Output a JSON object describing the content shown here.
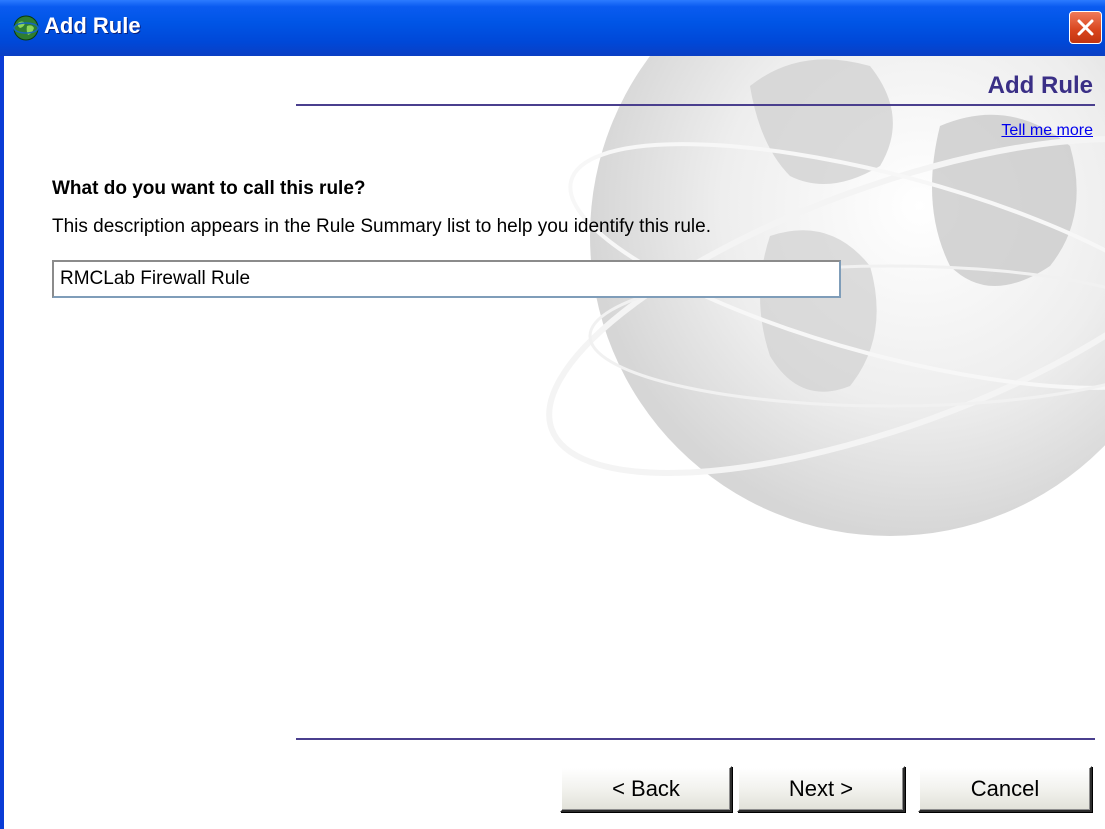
{
  "window": {
    "title": "Add Rule"
  },
  "header": {
    "title": "Add Rule",
    "help_link": "Tell me more"
  },
  "form": {
    "question": "What do you want to call this rule?",
    "description": "This description appears in the Rule Summary list to help you identify this rule.",
    "rule_name_value": "RMCLab Firewall Rule"
  },
  "buttons": {
    "back": "< Back",
    "next": "Next >",
    "cancel": "Cancel"
  },
  "colors": {
    "titlebar": "#0055e6",
    "accent_rule": "#4a3f8e",
    "header_text": "#3a2f86",
    "link": "#0000ee",
    "close": "#d8441c"
  }
}
